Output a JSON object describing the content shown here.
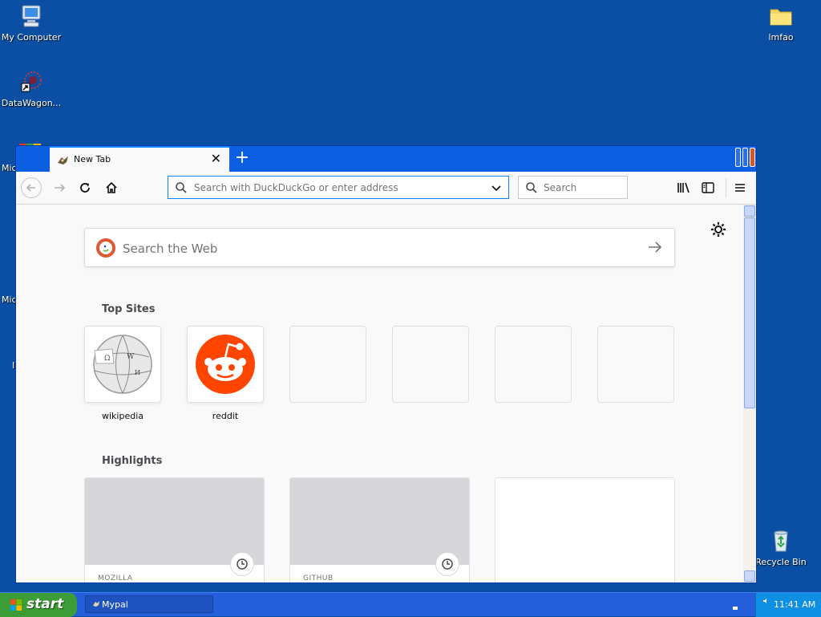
{
  "desktop": {
    "icons": {
      "my_computer": "My Computer",
      "datawagon": "DataWagon...",
      "lmfao": "lmfao",
      "recycle_bin": "Recycle Bin"
    },
    "partial_labels": [
      "Mic",
      "Mic",
      "I"
    ]
  },
  "browser": {
    "tab": {
      "title": "New Tab",
      "close_glyph": "✕"
    },
    "new_tab_glyph": "+",
    "urlbar": {
      "placeholder": "Search with DuckDuckGo or enter address"
    },
    "searchbox": {
      "placeholder": "Search"
    },
    "newtab_page": {
      "web_search_placeholder": "Search the Web",
      "top_sites_title": "Top Sites",
      "top_sites": [
        {
          "label": "wikipedia",
          "icon": "wikipedia-globe-icon"
        },
        {
          "label": "reddit",
          "icon": "reddit-alien-icon"
        },
        {
          "label": "",
          "icon": ""
        },
        {
          "label": "",
          "icon": ""
        },
        {
          "label": "",
          "icon": ""
        },
        {
          "label": "",
          "icon": ""
        }
      ],
      "highlights_title": "Highlights",
      "highlights": [
        {
          "source": "MOZILLA"
        },
        {
          "source": "GITHUB"
        }
      ]
    }
  },
  "taskbar": {
    "start_label": "start",
    "task_label": "Mypal",
    "clock": "11:41 AM"
  },
  "colors": {
    "desktop_bg": "#0a4fa3",
    "accent": "#0a84ff",
    "reddit": "#ff4500",
    "ddg": "#de5833",
    "start_green": "#3c9c35"
  }
}
